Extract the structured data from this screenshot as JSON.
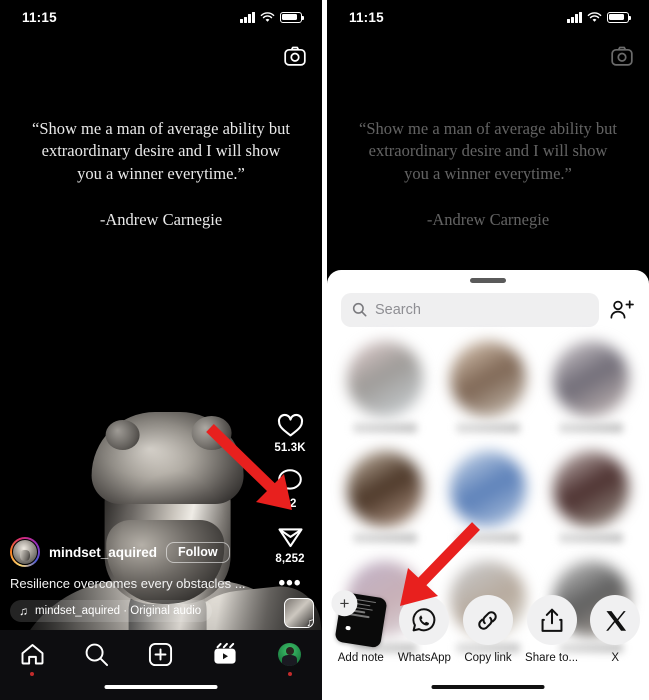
{
  "status_bar": {
    "time": "11:15",
    "signal_icon": "cellular-signal-icon",
    "wifi_icon": "wifi-icon",
    "battery_icon": "battery-icon"
  },
  "reel": {
    "camera_icon": "camera-icon",
    "quote_line_1": "“Show me a man of average ability but",
    "quote_line_2": "extraordinary desire and I will show",
    "quote_line_3": "you a winner everytime.”",
    "attribution": "-Andrew Carnegie",
    "username": "mindset_aquired",
    "follow_label": "Follow",
    "caption": "Resilience overcomes every obstacles ...",
    "audio_label": "mindset_aquired · Original audio",
    "audio_note_icon": "music-note-icon",
    "actions": [
      {
        "icon": "heart-icon",
        "count": "51.3K"
      },
      {
        "icon": "comment-bubble-icon",
        "count": "62"
      },
      {
        "icon": "share-paperplane-icon",
        "count": "8,252"
      },
      {
        "icon": "more-options-icon",
        "count": "•••"
      }
    ]
  },
  "tabbar": {
    "items": [
      {
        "name": "home",
        "icon": "home-icon",
        "badge_dot": true
      },
      {
        "name": "search",
        "icon": "search-magnifier-icon",
        "badge_dot": false
      },
      {
        "name": "create",
        "icon": "plus-square-icon",
        "badge_dot": false
      },
      {
        "name": "reels",
        "icon": "reels-clapper-icon",
        "badge_dot": false
      },
      {
        "name": "profile",
        "icon": "profile-avatar-icon",
        "badge_dot": true
      }
    ]
  },
  "share_sheet": {
    "grabber": "drag-handle",
    "search_placeholder": "Search",
    "search_icon": "search-magnifier-icon",
    "add_people_icon": "add-people-icon",
    "contacts_blurred_count": 9,
    "destinations": [
      {
        "label": "Add note",
        "icon": "add-note-icon"
      },
      {
        "label": "WhatsApp",
        "icon": "whatsapp-icon"
      },
      {
        "label": "Copy link",
        "icon": "link-chain-icon"
      },
      {
        "label": "Share to...",
        "icon": "share-upload-icon"
      },
      {
        "label": "X",
        "icon": "x-twitter-icon"
      }
    ]
  },
  "annotations": [
    {
      "name": "arrow-to-share-button",
      "color": "#e8201e",
      "points_to": "share-paperplane-icon"
    },
    {
      "name": "arrow-to-add-note",
      "color": "#e8201e",
      "points_to": "add-note-icon"
    }
  ],
  "colors": {
    "accent_red": "#e8201e",
    "sheet_bg": "#ffffff",
    "app_bg": "#000000",
    "chip_bg": "#f0f0f1"
  }
}
